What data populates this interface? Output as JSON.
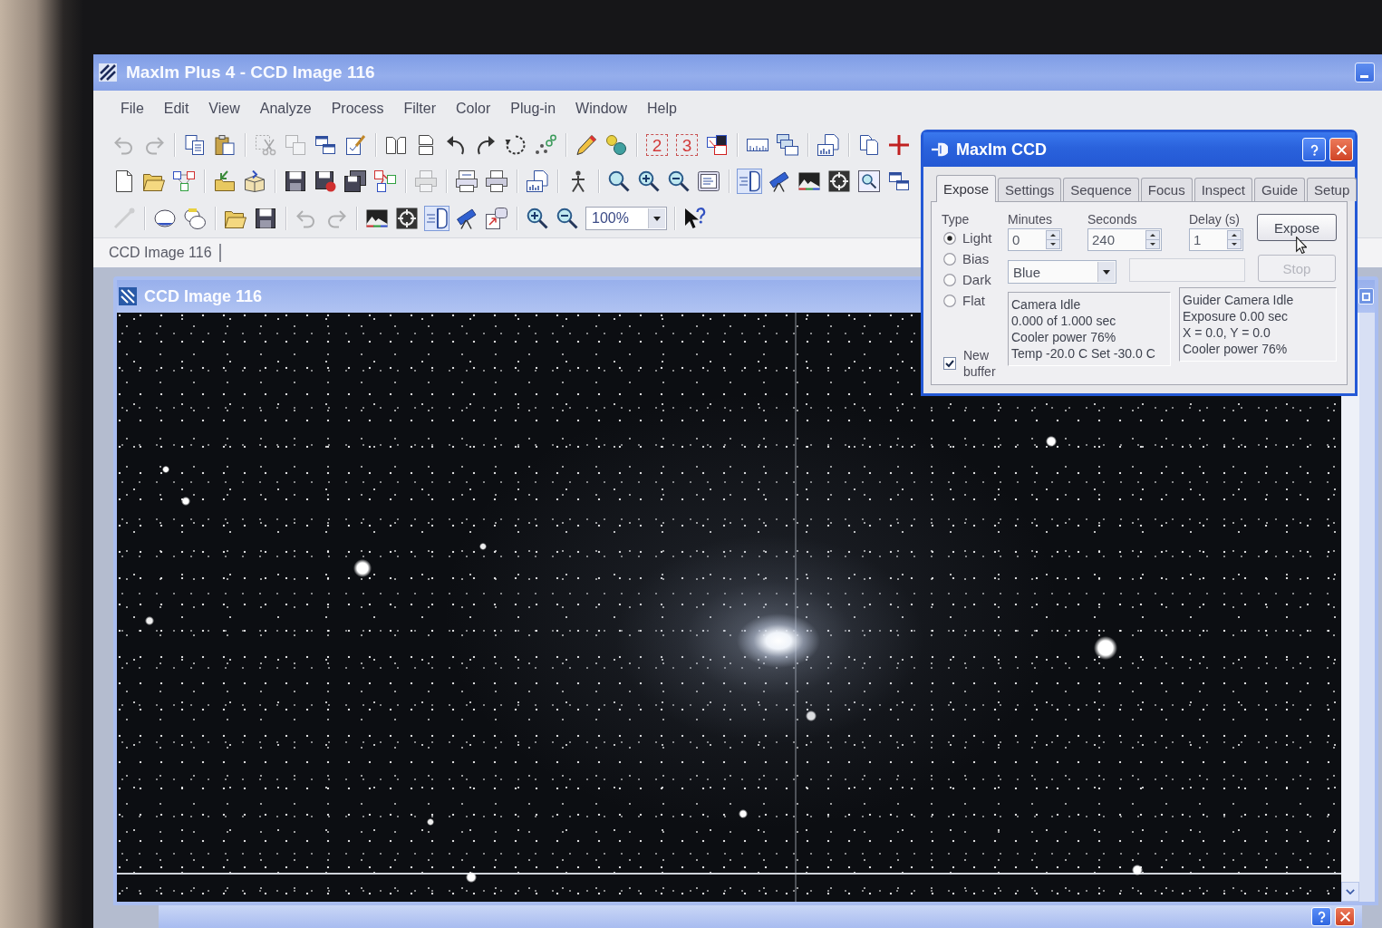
{
  "window": {
    "title": "MaxIm Plus 4 - CCD Image 116"
  },
  "menu": [
    "File",
    "Edit",
    "View",
    "Analyze",
    "Process",
    "Filter",
    "Color",
    "Plug-in",
    "Window",
    "Help"
  ],
  "toolbars": [
    {
      "buttons": [
        {
          "disabled": true,
          "pressed": false
        },
        {
          "disabled": true,
          "pressed": false
        },
        {
          "disabled": false,
          "pressed": false
        },
        {
          "disabled": false,
          "pressed": false
        },
        {
          "disabled": true,
          "pressed": false
        },
        {
          "disabled": true,
          "pressed": false
        },
        {
          "disabled": false,
          "pressed": false
        },
        {
          "disabled": false,
          "pressed": false
        },
        {
          "disabled": false,
          "pressed": false
        },
        {
          "disabled": false,
          "pressed": false
        },
        {
          "disabled": false,
          "pressed": false
        },
        {
          "disabled": false,
          "pressed": false
        },
        {
          "disabled": false,
          "pressed": false
        },
        {
          "disabled": false,
          "pressed": false
        },
        {
          "disabled": false,
          "pressed": false
        },
        {
          "disabled": false,
          "pressed": false
        },
        {
          "label": "2",
          "disabled": false,
          "pressed": false
        },
        {
          "label": "3",
          "disabled": false,
          "pressed": false
        },
        {
          "disabled": false,
          "pressed": false
        },
        {
          "disabled": false,
          "pressed": false
        },
        {
          "disabled": false,
          "pressed": false
        },
        {
          "disabled": false,
          "pressed": false
        },
        {
          "disabled": false,
          "pressed": false
        },
        {
          "disabled": false,
          "pressed": false
        }
      ]
    },
    {
      "buttons": [
        {
          "disabled": false,
          "pressed": false
        },
        {
          "disabled": false,
          "pressed": false
        },
        {
          "disabled": false,
          "pressed": false
        },
        {
          "disabled": false,
          "pressed": false
        },
        {
          "disabled": false,
          "pressed": false
        },
        {
          "disabled": false,
          "pressed": false
        },
        {
          "disabled": false,
          "pressed": false
        },
        {
          "disabled": false,
          "pressed": false
        },
        {
          "disabled": false,
          "pressed": false
        },
        {
          "disabled": true,
          "pressed": false
        },
        {
          "disabled": false,
          "pressed": false
        },
        {
          "disabled": false,
          "pressed": false
        },
        {
          "disabled": false,
          "pressed": false
        },
        {
          "disabled": false,
          "pressed": false
        },
        {
          "disabled": false,
          "pressed": false
        },
        {
          "disabled": false,
          "pressed": false
        },
        {
          "disabled": false,
          "pressed": false
        },
        {
          "disabled": false,
          "pressed": false
        },
        {
          "disabled": false,
          "pressed": true
        },
        {
          "disabled": false,
          "pressed": false
        },
        {
          "disabled": false,
          "pressed": false
        },
        {
          "disabled": false,
          "pressed": false
        },
        {
          "disabled": false,
          "pressed": false
        },
        {
          "disabled": false,
          "pressed": false
        }
      ]
    },
    {
      "buttons": [
        {
          "disabled": true,
          "pressed": false
        },
        {
          "disabled": false,
          "pressed": false
        },
        {
          "disabled": false,
          "pressed": false
        },
        {
          "disabled": false,
          "pressed": false
        },
        {
          "disabled": false,
          "pressed": false
        },
        {
          "disabled": true,
          "pressed": false
        },
        {
          "disabled": true,
          "pressed": false
        },
        {
          "disabled": false,
          "pressed": false
        },
        {
          "disabled": false,
          "pressed": false
        },
        {
          "disabled": false,
          "pressed": true
        },
        {
          "disabled": false,
          "pressed": false
        },
        {
          "disabled": false,
          "pressed": false
        },
        {
          "disabled": false,
          "pressed": false
        },
        {
          "disabled": false,
          "pressed": false
        }
      ],
      "zoom_field": {
        "value": "100%"
      },
      "trailing_buttons": [
        {
          "disabled": false,
          "pressed": false
        }
      ]
    }
  ],
  "document_tabs": [
    {
      "label": "CCD Image 116"
    }
  ],
  "image_window": {
    "title": "CCD Image 116"
  },
  "ccd_dialog": {
    "title": "MaxIm CCD",
    "tabs": [
      {
        "label": "Expose",
        "selected": true
      },
      {
        "label": "Settings",
        "selected": false
      },
      {
        "label": "Sequence",
        "selected": false
      },
      {
        "label": "Focus",
        "selected": false
      },
      {
        "label": "Inspect",
        "selected": false
      },
      {
        "label": "Guide",
        "selected": false
      },
      {
        "label": "Setup",
        "selected": false
      }
    ],
    "type_label": "Type",
    "types": [
      {
        "label": "Light",
        "selected": true
      },
      {
        "label": "Bias",
        "selected": false
      },
      {
        "label": "Dark",
        "selected": false
      },
      {
        "label": "Flat",
        "selected": false
      }
    ],
    "fields": [
      {
        "label": "Minutes",
        "value": "0"
      },
      {
        "label": "Seconds",
        "value": "240"
      },
      {
        "label": "Delay (s)",
        "value": "1"
      }
    ],
    "buttons": [
      {
        "label": "Expose",
        "disabled": false
      },
      {
        "label": "Stop",
        "disabled": true
      }
    ],
    "filter": {
      "value": "Blue"
    },
    "camera_status": [
      "Camera Idle",
      "0.000 of 1.000 sec",
      "Cooler power 76%",
      "Temp -20.0 C Set -30.0 C"
    ],
    "guider_status": [
      "Guider Camera Idle",
      "Exposure 0.00 sec",
      "X = 0.0, Y = 0.0",
      "Cooler power 76%"
    ],
    "new_buffer": {
      "label": "New buffer",
      "checked": true
    }
  }
}
